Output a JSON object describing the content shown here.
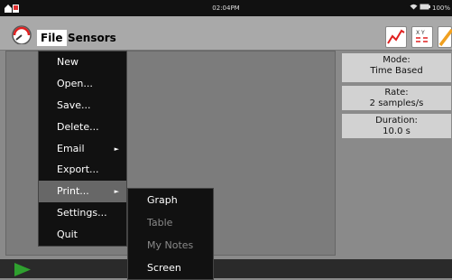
{
  "status": {
    "time": "02:04PM",
    "battery": "100%"
  },
  "menubar": {
    "file": "File",
    "sensors": "Sensors"
  },
  "file_menu": {
    "items": [
      "New",
      "Open...",
      "Save...",
      "Delete...",
      "Email",
      "Export...",
      "Print...",
      "Settings...",
      "Quit"
    ]
  },
  "print_submenu": {
    "items": [
      "Graph",
      "Table",
      "My Notes",
      "Screen"
    ]
  },
  "sidebar": {
    "mode": {
      "label": "Mode:",
      "value": "Time Based"
    },
    "rate": {
      "label": "Rate:",
      "value": "2 samples/s"
    },
    "duration": {
      "label": "Duration:",
      "value": "10.0 s"
    }
  },
  "toolbar": {
    "table_icon_letters": "X Y"
  },
  "colors": {
    "accent_red": "#e02020",
    "play_green": "#2fa02f",
    "pencil_orange": "#f0a020"
  }
}
